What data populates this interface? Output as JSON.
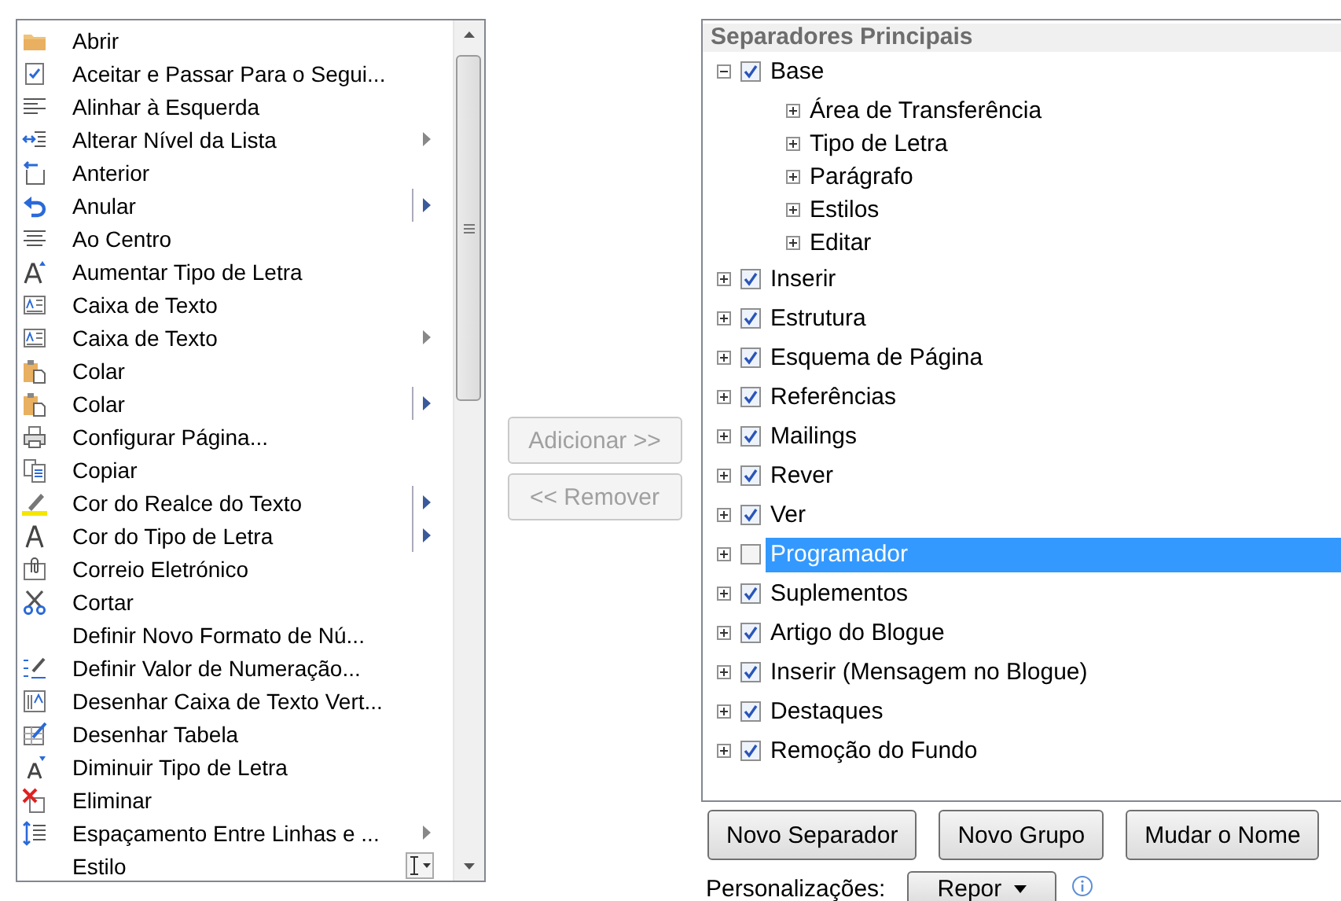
{
  "commands": {
    "items": [
      {
        "label": "Abrir"
      },
      {
        "label": "Aceitar e Passar Para o Segui..."
      },
      {
        "label": "Alinhar à Esquerda"
      },
      {
        "label": "Alterar Nível da Lista",
        "kind": "arrow"
      },
      {
        "label": "Anterior"
      },
      {
        "label": "Anular",
        "kind": "split"
      },
      {
        "label": "Ao Centro"
      },
      {
        "label": "Aumentar Tipo de Letra"
      },
      {
        "label": "Caixa de Texto"
      },
      {
        "label": "Caixa de Texto",
        "kind": "arrow"
      },
      {
        "label": "Colar"
      },
      {
        "label": "Colar",
        "kind": "split"
      },
      {
        "label": "Configurar Página..."
      },
      {
        "label": "Copiar"
      },
      {
        "label": "Cor do Realce do Texto",
        "kind": "split"
      },
      {
        "label": "Cor do Tipo de Letra",
        "kind": "split"
      },
      {
        "label": "Correio Eletrónico"
      },
      {
        "label": "Cortar"
      },
      {
        "label": "Definir Novo Formato de Nú..."
      },
      {
        "label": "Definir Valor de Numeração..."
      },
      {
        "label": "Desenhar Caixa de Texto Vert..."
      },
      {
        "label": "Desenhar Tabela"
      },
      {
        "label": "Diminuir Tipo de Letra"
      },
      {
        "label": "Eliminar"
      },
      {
        "label": "Espaçamento Entre Linhas e ...",
        "kind": "arrow"
      },
      {
        "label": "Estilo",
        "kind": "style"
      }
    ]
  },
  "transfer_buttons": [
    {
      "label": "Adicionar >>",
      "disabled": true
    },
    {
      "label": "<< Remover",
      "disabled": true
    }
  ],
  "tabs_tree": {
    "header": "Separadores Principais",
    "items": [
      {
        "label": "Base",
        "checked": true,
        "expanded": true,
        "selected": false,
        "children": [
          {
            "label": "Área de Transferência",
            "expanded": false
          },
          {
            "label": "Tipo de Letra",
            "expanded": false
          },
          {
            "label": "Parágrafo",
            "expanded": false
          },
          {
            "label": "Estilos",
            "expanded": false
          },
          {
            "label": "Editar",
            "expanded": false
          }
        ]
      },
      {
        "label": "Inserir",
        "checked": true,
        "expanded": false,
        "selected": false
      },
      {
        "label": "Estrutura",
        "checked": true,
        "expanded": false,
        "selected": false
      },
      {
        "label": "Esquema de Página",
        "checked": true,
        "expanded": false,
        "selected": false
      },
      {
        "label": "Referências",
        "checked": true,
        "expanded": false,
        "selected": false
      },
      {
        "label": "Mailings",
        "checked": true,
        "expanded": false,
        "selected": false
      },
      {
        "label": "Rever",
        "checked": true,
        "expanded": false,
        "selected": false
      },
      {
        "label": "Ver",
        "checked": true,
        "expanded": false,
        "selected": false
      },
      {
        "label": "Programador",
        "checked": false,
        "expanded": false,
        "selected": true
      },
      {
        "label": "Suplementos",
        "checked": true,
        "expanded": false,
        "selected": false
      },
      {
        "label": "Artigo do Blogue",
        "checked": true,
        "expanded": false,
        "selected": false
      },
      {
        "label": "Inserir (Mensagem no Blogue)",
        "checked": true,
        "expanded": false,
        "selected": false
      },
      {
        "label": "Destaques",
        "checked": true,
        "expanded": false,
        "selected": false
      },
      {
        "label": "Remoção do Fundo",
        "checked": true,
        "expanded": false,
        "selected": false
      }
    ]
  },
  "tree_buttons": [
    {
      "label": "Novo Separador"
    },
    {
      "label": "Novo Grupo"
    },
    {
      "label": "Mudar o Nome"
    }
  ],
  "customizations": {
    "label": "Personalizações:",
    "reset_button": "Repor"
  }
}
